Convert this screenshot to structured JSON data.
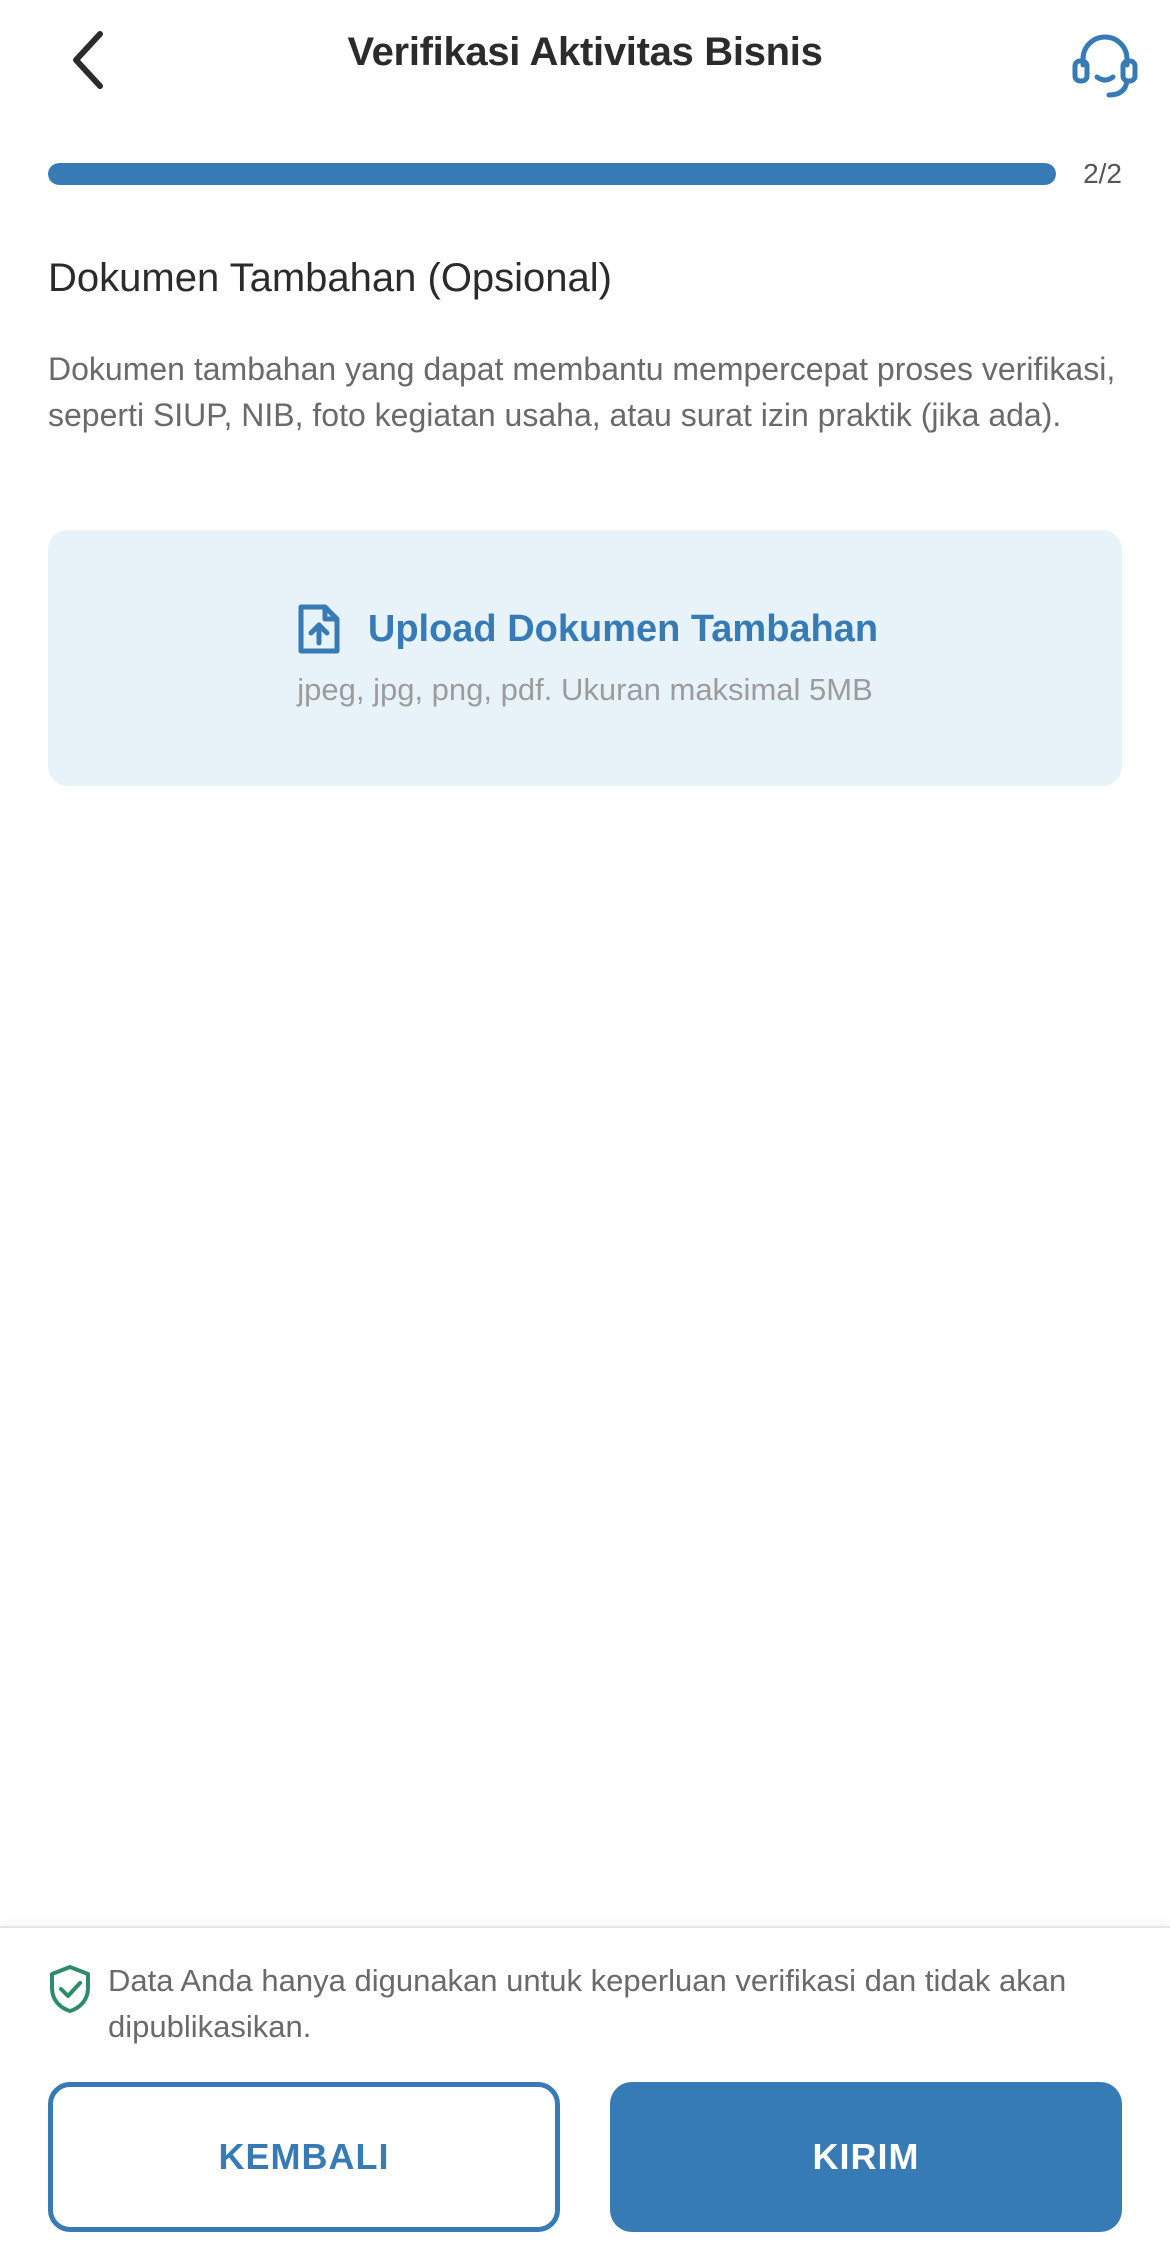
{
  "header": {
    "title": "Verifikasi Aktivitas Bisnis",
    "back_icon": "chevron-left-icon",
    "support_icon": "headset-icon",
    "accent_color": "#367bb6"
  },
  "progress": {
    "label": "2/2",
    "current_step": 2,
    "total_steps": 2,
    "fraction": 1.0
  },
  "section": {
    "title": "Dokumen Tambahan (Opsional)",
    "description": "Dokumen tambahan yang dapat membantu mempercepat proses verifikasi, seperti SIUP, NIB, foto kegiatan usaha, atau surat izin praktik (jika ada)."
  },
  "upload": {
    "icon": "file-upload-icon",
    "label": "Upload Dokumen Tambahan",
    "hint": "jpeg, jpg, png, pdf. Ukuran maksimal 5MB",
    "background_color": "#e7f2f9"
  },
  "footer": {
    "privacy_icon": "shield-check-icon",
    "privacy_text": "Data Anda hanya digunakan untuk keperluan verifikasi dan tidak akan dipublikasikan.",
    "back_label": "KEMBALI",
    "submit_label": "KIRIM"
  }
}
